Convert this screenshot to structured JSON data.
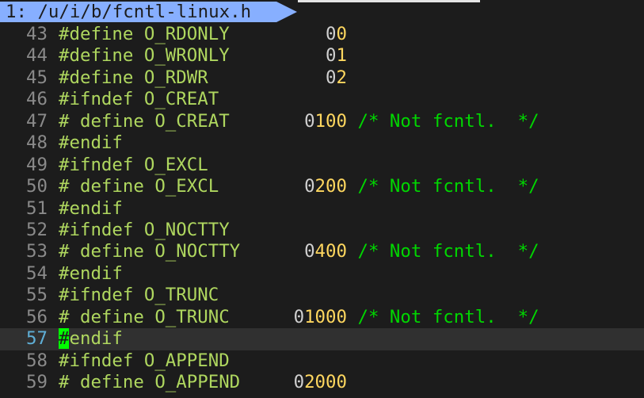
{
  "tabline": {
    "active_tab": "1: /u/i/b/fcntl-linux.h"
  },
  "editor": {
    "lines": [
      {
        "num": "43",
        "code": "#define O_RDONLY         ",
        "zero": "0",
        "value": "0",
        "comment": "",
        "current": false
      },
      {
        "num": "44",
        "code": "#define O_WRONLY         ",
        "zero": "0",
        "value": "1",
        "comment": "",
        "current": false
      },
      {
        "num": "45",
        "code": "#define O_RDWR           ",
        "zero": "0",
        "value": "2",
        "comment": "",
        "current": false
      },
      {
        "num": "46",
        "code": "#ifndef O_CREAT",
        "zero": "",
        "value": "",
        "comment": "",
        "current": false
      },
      {
        "num": "47",
        "code": "# define O_CREAT       ",
        "zero": "0",
        "value": "100",
        "comment": " /* Not fcntl.  */",
        "current": false
      },
      {
        "num": "48",
        "code": "#endif",
        "zero": "",
        "value": "",
        "comment": "",
        "current": false
      },
      {
        "num": "49",
        "code": "#ifndef O_EXCL",
        "zero": "",
        "value": "",
        "comment": "",
        "current": false
      },
      {
        "num": "50",
        "code": "# define O_EXCL        ",
        "zero": "0",
        "value": "200",
        "comment": " /* Not fcntl.  */",
        "current": false
      },
      {
        "num": "51",
        "code": "#endif",
        "zero": "",
        "value": "",
        "comment": "",
        "current": false
      },
      {
        "num": "52",
        "code": "#ifndef O_NOCTTY",
        "zero": "",
        "value": "",
        "comment": "",
        "current": false
      },
      {
        "num": "53",
        "code": "# define O_NOCTTY      ",
        "zero": "0",
        "value": "400",
        "comment": " /* Not fcntl.  */",
        "current": false
      },
      {
        "num": "54",
        "code": "#endif",
        "zero": "",
        "value": "",
        "comment": "",
        "current": false
      },
      {
        "num": "55",
        "code": "#ifndef O_TRUNC",
        "zero": "",
        "value": "",
        "comment": "",
        "current": false
      },
      {
        "num": "56",
        "code": "# define O_TRUNC      ",
        "zero": "0",
        "value": "1000",
        "comment": " /* Not fcntl.  */",
        "current": false
      },
      {
        "num": "57",
        "code": "endif",
        "zero": "",
        "value": "",
        "comment": "",
        "current": true,
        "cursor_char": "#"
      },
      {
        "num": "58",
        "code": "#ifndef O_APPEND",
        "zero": "",
        "value": "",
        "comment": "",
        "current": false
      },
      {
        "num": "59",
        "code": "# define O_APPEND     ",
        "zero": "0",
        "value": "2000",
        "comment": "",
        "current": false
      }
    ]
  },
  "colors": {
    "background": "#1c1c1c",
    "tab_active": "#87afff",
    "preprocessor": "#afd75f",
    "number": "#ffd75f",
    "comment": "#00d700",
    "cursor": "#00ff00",
    "line_number": "#8a8a8a",
    "current_line_number": "#5fafd7"
  }
}
